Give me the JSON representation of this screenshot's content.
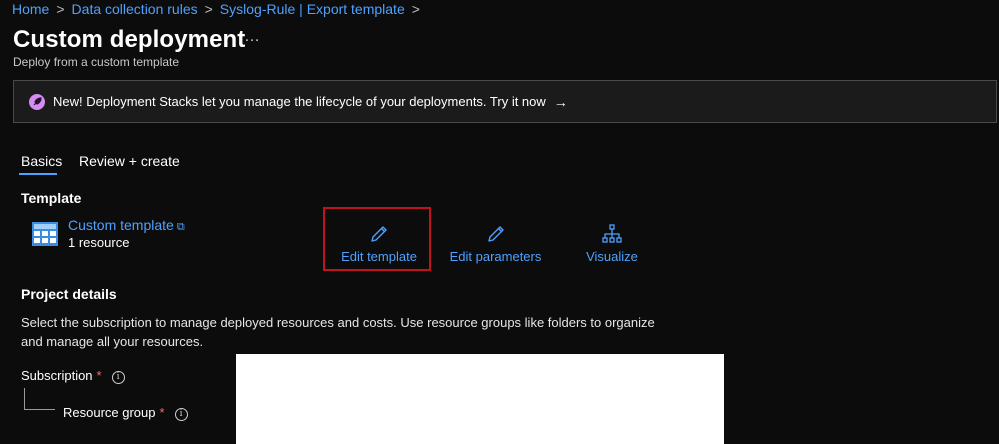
{
  "breadcrumb": {
    "items": [
      "Home",
      "Data collection rules",
      "Syslog-Rule | Export template"
    ],
    "separator": ">"
  },
  "page": {
    "title": "Custom deployment",
    "more": "…",
    "subtitle": "Deploy from a custom template"
  },
  "banner": {
    "text": "New! Deployment Stacks let you manage the lifecycle of your deployments. Try it now",
    "arrow": "→"
  },
  "tabs": [
    {
      "label": "Basics",
      "active": true
    },
    {
      "label": "Review + create",
      "active": false
    }
  ],
  "template": {
    "heading": "Template",
    "name": "Custom template",
    "ext_icon": "⧉",
    "count": "1 resource",
    "actions": {
      "edit_template": "Edit template",
      "edit_parameters": "Edit parameters",
      "visualize": "Visualize"
    }
  },
  "project": {
    "heading": "Project details",
    "description": "Select the subscription to manage deployed resources and costs. Use resource groups like folders to organize and manage all your resources.",
    "fields": {
      "subscription": "Subscription",
      "resource_group": "Resource group",
      "required_mark": "*",
      "info_mark": "i"
    }
  },
  "colors": {
    "background": "#0c0c0c",
    "link": "#4ea1ff",
    "highlight_box": "#c0121f",
    "banner_icon": "#d48cf0"
  },
  "icons": [
    "rocket-icon",
    "arrow-right-icon",
    "template-grid-icon",
    "external-link-icon",
    "pencil-icon",
    "hierarchy-icon",
    "info-icon"
  ]
}
